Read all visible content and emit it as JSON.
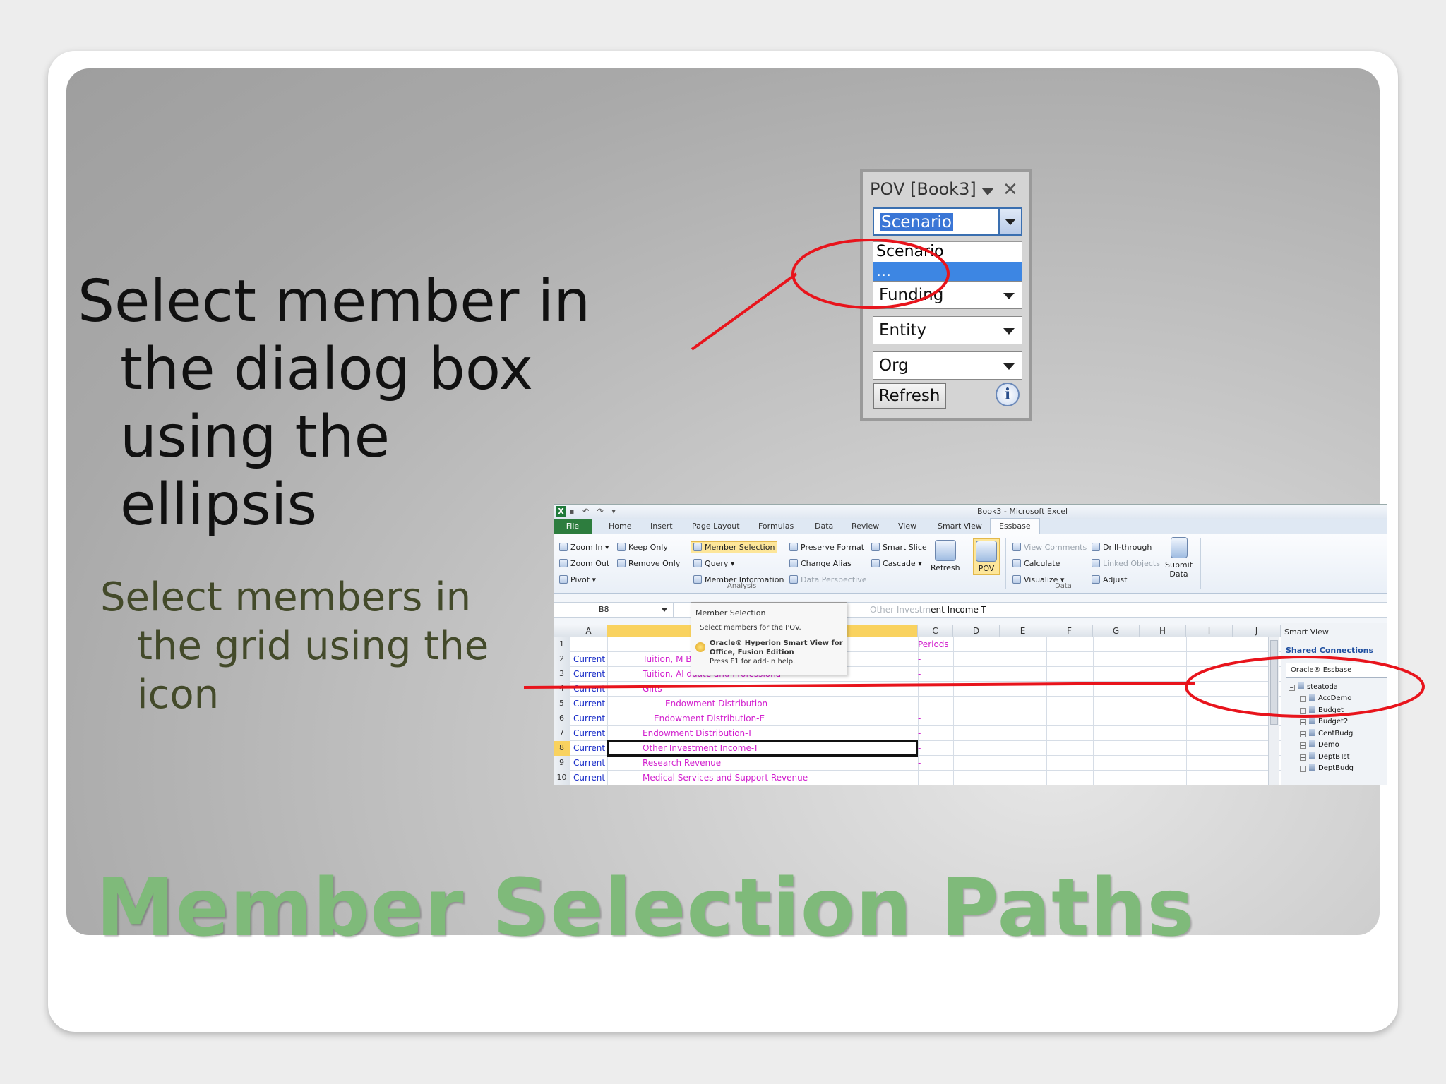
{
  "slide": {
    "heading_lines": [
      "Select member in",
      "the dialog box",
      "using the",
      "ellipsis"
    ],
    "subheading_lines": [
      "Select members in",
      "the grid using the",
      "icon"
    ],
    "title": "Member Selection Paths"
  },
  "pov_panel": {
    "title": "POV [Book3]",
    "scenario_value": "Scenario",
    "dropdown_options": [
      "Scenario",
      "..."
    ],
    "selected_option": "...",
    "funding": "Funding",
    "entity": "Entity",
    "org": "Org",
    "refresh_label": "Refresh",
    "info_label": "i"
  },
  "excel": {
    "window_title": "Book3 - Microsoft Excel",
    "app_icon": "X",
    "tabs": [
      "File",
      "Home",
      "Insert",
      "Page Layout",
      "Formulas",
      "Data",
      "Review",
      "View",
      "Smart View",
      "Essbase"
    ],
    "active_tab": "Essbase",
    "ribbon": {
      "zoom_in": "Zoom In",
      "zoom_out": "Zoom Out",
      "pivot": "Pivot",
      "keep_only": "Keep Only",
      "remove_only": "Remove Only",
      "member_selection": "Member Selection",
      "query": "Query",
      "member_information": "Member Information",
      "preserve_format": "Preserve Format",
      "change_alias": "Change Alias",
      "data_perspective": "Data Perspective",
      "smart_slice": "Smart Slice",
      "cascade": "Cascade",
      "refresh": "Refresh",
      "pov": "POV",
      "view_comments": "View Comments",
      "calculate": "Calculate",
      "visualize": "Visualize",
      "drill_through": "Drill-through",
      "linked_objects": "Linked Objects",
      "adjust": "Adjust",
      "submit_data_1": "Submit",
      "submit_data_2": "Data",
      "group_analysis": "Analysis",
      "group_data": "Data"
    },
    "name_box": "B8",
    "formula_ghost": "Other Investm",
    "formula_value": "ent Income-T",
    "tooltip": {
      "title": "Member Selection",
      "description": "Select members for the POV.",
      "product_1": "Oracle® Hyperion Smart View for",
      "product_2": "Office, Fusion Edition",
      "help": "Press F1 for add-in help."
    },
    "columns": [
      "A",
      "",
      "C",
      "D",
      "E",
      "F",
      "G",
      "H",
      "I",
      "J"
    ],
    "rows": [
      {
        "n": "1",
        "a": "",
        "b": "",
        "c": "Periods"
      },
      {
        "n": "2",
        "a": "Current",
        "b": "Tuition, M                     Board - Undergraduate",
        "c": "-"
      },
      {
        "n": "3",
        "a": "Current",
        "b": "Tuition, Al                              duate and Professiona",
        "c": "-"
      },
      {
        "n": "4",
        "a": "Current",
        "b": "Gifts",
        "c": ""
      },
      {
        "n": "5",
        "a": "Current",
        "b": "Endowment Distribution",
        "c": "-"
      },
      {
        "n": "6",
        "a": "Current",
        "b": "Endowment Distribution-E",
        "c": "-"
      },
      {
        "n": "7",
        "a": "Current",
        "b": "Endowment Distribution-T",
        "c": "-"
      },
      {
        "n": "8",
        "a": "Current",
        "b": "Other Investment Income-T",
        "c": "-"
      },
      {
        "n": "9",
        "a": "Current",
        "b": "Research Revenue",
        "c": "-"
      },
      {
        "n": "10",
        "a": "Current",
        "b": "Medical Services and Support Revenue",
        "c": "-"
      }
    ],
    "smart_view": {
      "title": "Smart View",
      "shared_connections": "Shared Connections",
      "provider": "Oracle® Essbase",
      "server": "steatoda",
      "apps": [
        "AccDemo",
        "Budget",
        "Budget2",
        "CentBudg",
        "Demo",
        "DeptBTst",
        "DeptBudg"
      ]
    }
  },
  "colors": {
    "annotation_red": "#e8141c",
    "title_green": "#7fba7a",
    "member_blue": "#1a2ec8",
    "member_magenta": "#d21fce"
  }
}
